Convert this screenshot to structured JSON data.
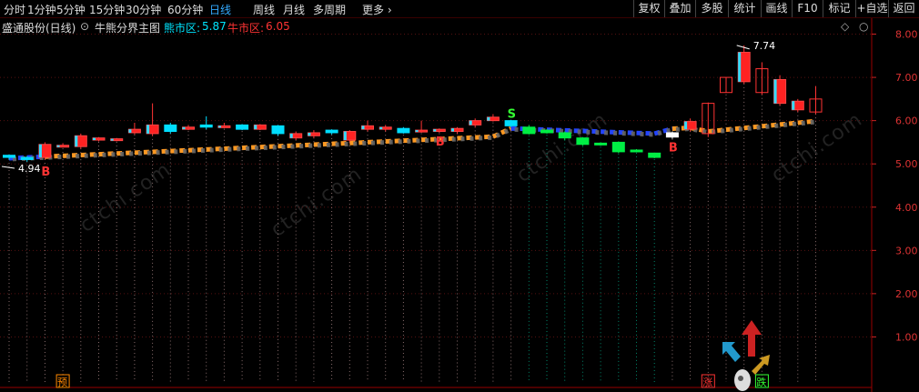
{
  "toolbar": {
    "left": [
      {
        "label": "分时",
        "active": false
      },
      {
        "label": "1分钟",
        "active": false
      },
      {
        "label": "5分钟",
        "active": false
      },
      {
        "label": "15分钟",
        "active": false
      },
      {
        "label": "30分钟",
        "active": false
      },
      {
        "label": "60分钟",
        "active": false
      },
      {
        "label": "日线",
        "active": true
      },
      {
        "label": "周线",
        "active": false
      },
      {
        "label": "月线",
        "active": false
      },
      {
        "label": "多周期",
        "active": false
      },
      {
        "label": "更多",
        "active": false
      }
    ],
    "right": [
      "复权",
      "叠加",
      "多股",
      "统计",
      "画线",
      "F10",
      "标记",
      "+自选",
      "返回"
    ]
  },
  "header": {
    "stock": "盛通股份(日线)",
    "indicator": "牛熊分界主图",
    "bear_label": "熊市区:",
    "bear_value": "5.87",
    "bull_label": "牛市区:",
    "bull_value": "6.05",
    "bear_color": "#00e5ff",
    "bull_color": "#ff3333"
  },
  "chart_data": {
    "type": "candlestick",
    "y_ticks": [
      "8.00",
      "7.00",
      "6.00",
      "5.00",
      "4.00",
      "3.00",
      "2.00",
      "1.00"
    ],
    "ylim": [
      0.0,
      8.2
    ],
    "candles": [
      {
        "o": 5.15,
        "c": 5.2,
        "h": 5.22,
        "l": 5.1,
        "d": "down"
      },
      {
        "o": 5.1,
        "c": 5.15,
        "h": 5.18,
        "l": 5.05,
        "d": "down"
      },
      {
        "o": 5.15,
        "c": 5.45,
        "h": 5.5,
        "l": 5.1,
        "d": "up"
      },
      {
        "o": 5.4,
        "c": 5.43,
        "h": 5.48,
        "l": 5.38,
        "d": "up"
      },
      {
        "o": 5.4,
        "c": 5.65,
        "h": 5.7,
        "l": 5.35,
        "d": "up"
      },
      {
        "o": 5.55,
        "c": 5.6,
        "h": 5.62,
        "l": 5.52,
        "d": "up"
      },
      {
        "o": 5.55,
        "c": 5.58,
        "h": 5.6,
        "l": 5.52,
        "d": "up"
      },
      {
        "o": 5.72,
        "c": 5.8,
        "h": 5.95,
        "l": 5.68,
        "d": "up"
      },
      {
        "o": 5.7,
        "c": 5.9,
        "h": 6.4,
        "l": 5.65,
        "d": "up"
      },
      {
        "o": 5.9,
        "c": 5.75,
        "h": 5.95,
        "l": 5.7,
        "d": "down"
      },
      {
        "o": 5.8,
        "c": 5.85,
        "h": 5.9,
        "l": 5.78,
        "d": "up"
      },
      {
        "o": 5.9,
        "c": 5.85,
        "h": 6.1,
        "l": 5.8,
        "d": "down"
      },
      {
        "o": 5.85,
        "c": 5.88,
        "h": 5.95,
        "l": 5.82,
        "d": "up"
      },
      {
        "o": 5.9,
        "c": 5.8,
        "h": 5.92,
        "l": 5.78,
        "d": "down"
      },
      {
        "o": 5.9,
        "c": 5.8,
        "h": 5.92,
        "l": 5.78,
        "d": "up"
      },
      {
        "o": 5.88,
        "c": 5.7,
        "h": 5.9,
        "l": 5.65,
        "d": "down"
      },
      {
        "o": 5.6,
        "c": 5.7,
        "h": 5.75,
        "l": 5.55,
        "d": "up"
      },
      {
        "o": 5.65,
        "c": 5.72,
        "h": 5.78,
        "l": 5.6,
        "d": "up"
      },
      {
        "o": 5.72,
        "c": 5.78,
        "h": 5.8,
        "l": 5.68,
        "d": "down"
      },
      {
        "o": 5.75,
        "c": 5.55,
        "h": 5.78,
        "l": 5.5,
        "d": "up"
      },
      {
        "o": 5.8,
        "c": 5.88,
        "h": 6.0,
        "l": 5.75,
        "d": "up"
      },
      {
        "o": 5.8,
        "c": 5.85,
        "h": 5.9,
        "l": 5.75,
        "d": "up"
      },
      {
        "o": 5.82,
        "c": 5.72,
        "h": 5.85,
        "l": 5.7,
        "d": "down"
      },
      {
        "o": 5.75,
        "c": 5.78,
        "h": 6.0,
        "l": 5.72,
        "d": "up"
      },
      {
        "o": 5.75,
        "c": 5.8,
        "h": 5.82,
        "l": 5.72,
        "d": "up"
      },
      {
        "o": 5.75,
        "c": 5.82,
        "h": 5.85,
        "l": 5.7,
        "d": "up"
      },
      {
        "o": 5.9,
        "c": 6.0,
        "h": 6.05,
        "l": 5.85,
        "d": "up"
      },
      {
        "o": 6.0,
        "c": 6.08,
        "h": 6.15,
        "l": 5.98,
        "d": "up"
      },
      {
        "o": 6.0,
        "c": 5.88,
        "h": 6.02,
        "l": 5.85,
        "d": "down"
      },
      {
        "o": 5.85,
        "c": 5.7,
        "h": 5.9,
        "l": 5.68,
        "d": "green"
      },
      {
        "o": 5.78,
        "c": 5.72,
        "h": 5.8,
        "l": 5.7,
        "d": "green"
      },
      {
        "o": 5.72,
        "c": 5.6,
        "h": 5.75,
        "l": 5.55,
        "d": "green"
      },
      {
        "o": 5.6,
        "c": 5.45,
        "h": 5.62,
        "l": 5.42,
        "d": "green"
      },
      {
        "o": 5.48,
        "c": 5.44,
        "h": 5.5,
        "l": 5.42,
        "d": "green"
      },
      {
        "o": 5.5,
        "c": 5.28,
        "h": 5.52,
        "l": 5.25,
        "d": "green"
      },
      {
        "o": 5.32,
        "c": 5.3,
        "h": 5.34,
        "l": 5.28,
        "d": "green"
      },
      {
        "o": 5.25,
        "c": 5.15,
        "h": 5.26,
        "l": 5.13,
        "d": "green"
      },
      {
        "o": 5.62,
        "c": 5.72,
        "h": 5.75,
        "l": 5.58,
        "d": "white"
      },
      {
        "o": 5.8,
        "c": 5.98,
        "h": 6.05,
        "l": 5.75,
        "d": "up"
      },
      {
        "o": 5.7,
        "c": 6.4,
        "h": 6.42,
        "l": 5.62,
        "d": "hollow"
      },
      {
        "o": 6.65,
        "c": 7.0,
        "h": 7.0,
        "l": 6.65,
        "d": "hollow"
      },
      {
        "o": 6.9,
        "c": 7.58,
        "h": 7.74,
        "l": 6.85,
        "d": "up"
      },
      {
        "o": 7.2,
        "c": 6.65,
        "h": 7.35,
        "l": 6.6,
        "d": "hollow"
      },
      {
        "o": 6.4,
        "c": 6.95,
        "h": 7.05,
        "l": 6.35,
        "d": "up"
      },
      {
        "o": 6.25,
        "c": 6.45,
        "h": 6.5,
        "l": 6.2,
        "d": "up"
      },
      {
        "o": 6.2,
        "c": 6.5,
        "h": 6.8,
        "l": 6.15,
        "d": "hollow"
      }
    ],
    "annotations": [
      {
        "text": "4.94",
        "i": 0,
        "y": 4.94,
        "color": "#ffffff"
      },
      {
        "text": "7.74",
        "i": 41,
        "y": 7.74,
        "color": "#ffffff"
      }
    ],
    "signals": [
      {
        "text": "B",
        "i": 2,
        "color": "#ff3333"
      },
      {
        "text": "B",
        "i": 24,
        "color": "#ff3333"
      },
      {
        "text": "S",
        "i": 28,
        "color": "#33ff33"
      },
      {
        "text": "B",
        "i": 37,
        "color": "#ff3333"
      }
    ],
    "bottom_marks": [
      {
        "text": "预",
        "i": 3,
        "color": "#ff8800"
      },
      {
        "text": "涨",
        "i": 39,
        "color": "#ff3333"
      },
      {
        "text": "跌",
        "i": 42,
        "color": "#33ff33"
      }
    ]
  },
  "watermark": "ctchi.com"
}
